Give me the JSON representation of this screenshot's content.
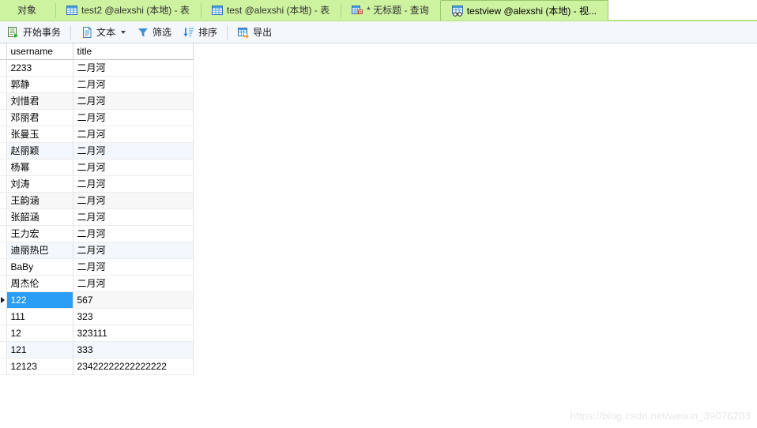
{
  "tabs": [
    {
      "label": "对象",
      "icon": "none",
      "active": false
    },
    {
      "label": "test2 @alexshi (本地) - 表",
      "icon": "table-icon",
      "active": false
    },
    {
      "label": "test @alexshi (本地) - 表",
      "icon": "table-icon",
      "active": false
    },
    {
      "label": "* 无标题 - 查询",
      "icon": "query-icon",
      "active": false
    },
    {
      "label": "testview @alexshi (本地) - 视...",
      "icon": "view-icon",
      "active": true
    }
  ],
  "toolbar": {
    "begin_transaction": "开始事务",
    "text": "文本",
    "filter": "筛选",
    "sort": "排序",
    "export": "导出"
  },
  "grid": {
    "columns": [
      "username",
      "title"
    ],
    "selected_cell": {
      "row": 14,
      "column": 0
    },
    "rows": [
      {
        "username": "2233",
        "title": "二月河",
        "style": "plain"
      },
      {
        "username": "郭静",
        "title": "二月河",
        "style": "plain"
      },
      {
        "username": "刘惜君",
        "title": "二月河",
        "style": "stripe"
      },
      {
        "username": "邓丽君",
        "title": "二月河",
        "style": "plain"
      },
      {
        "username": "张曼玉",
        "title": "二月河",
        "style": "plain"
      },
      {
        "username": "赵丽颖",
        "title": "二月河",
        "style": "hover"
      },
      {
        "username": "杨幂",
        "title": "二月河",
        "style": "plain"
      },
      {
        "username": "刘涛",
        "title": "二月河",
        "style": "plain"
      },
      {
        "username": "王韵涵",
        "title": "二月河",
        "style": "stripe"
      },
      {
        "username": "张韶涵",
        "title": "二月河",
        "style": "plain"
      },
      {
        "username": "王力宏",
        "title": "二月河",
        "style": "plain"
      },
      {
        "username": "迪丽热巴",
        "title": "二月河",
        "style": "hover"
      },
      {
        "username": "BaBy",
        "title": "二月河",
        "style": "plain"
      },
      {
        "username": "周杰伦",
        "title": "二月河",
        "style": "plain"
      },
      {
        "username": "122",
        "title": "567",
        "style": "stripe"
      },
      {
        "username": "111",
        "title": "323",
        "style": "plain"
      },
      {
        "username": "12",
        "title": "323111",
        "style": "plain"
      },
      {
        "username": "121",
        "title": "333",
        "style": "hover"
      },
      {
        "username": "12123",
        "title": "23422222222222222",
        "style": "plain"
      }
    ]
  },
  "watermark": "https://blog.csdn.net/weixin_39076203",
  "colors": {
    "tabbar_bg": "#cdf2a0",
    "toolbar_bg": "#f4f7fb",
    "header_username_bg": "#d6effa",
    "selection_blue": "#2a9df4",
    "watermark_gray": "#e8e8e8"
  }
}
